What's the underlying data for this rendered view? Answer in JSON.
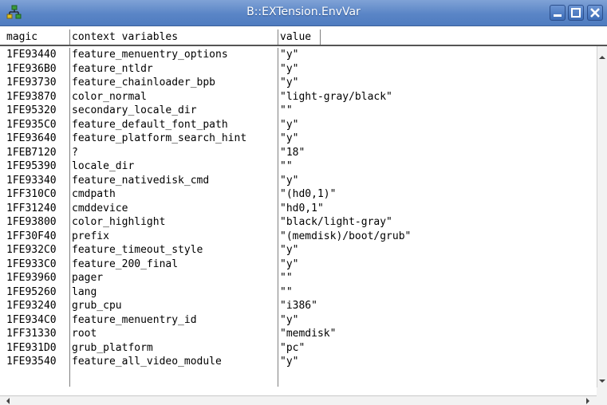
{
  "window": {
    "title": "B::EXTension.EnvVar",
    "icon": "app-network-icon",
    "controls": [
      "minimize-icon",
      "maximize-icon",
      "close-icon"
    ],
    "titlebar_color": "#5a85c6"
  },
  "table": {
    "headers": {
      "magic": "magic",
      "name": "context variables",
      "value": "value"
    },
    "rows": [
      {
        "magic": "1FE93440",
        "name": "feature_menuentry_options",
        "value": "\"y\""
      },
      {
        "magic": "1FE936B0",
        "name": "feature_ntldr",
        "value": "\"y\""
      },
      {
        "magic": "1FE93730",
        "name": "feature_chainloader_bpb",
        "value": "\"y\""
      },
      {
        "magic": "1FE93870",
        "name": "color_normal",
        "value": "\"light-gray/black\""
      },
      {
        "magic": "1FE95320",
        "name": "secondary_locale_dir",
        "value": "\"\""
      },
      {
        "magic": "1FE935C0",
        "name": "feature_default_font_path",
        "value": "\"y\""
      },
      {
        "magic": "1FE93640",
        "name": "feature_platform_search_hint",
        "value": "\"y\""
      },
      {
        "magic": "1FEB7120",
        "name": "?",
        "value": "\"18\""
      },
      {
        "magic": "1FE95390",
        "name": "locale_dir",
        "value": "\"\""
      },
      {
        "magic": "1FE93340",
        "name": "feature_nativedisk_cmd",
        "value": "\"y\""
      },
      {
        "magic": "1FF310C0",
        "name": "cmdpath",
        "value": "\"(hd0,1)\""
      },
      {
        "magic": "1FF31240",
        "name": "cmddevice",
        "value": "\"hd0,1\""
      },
      {
        "magic": "1FE93800",
        "name": "color_highlight",
        "value": "\"black/light-gray\""
      },
      {
        "magic": "1FF30F40",
        "name": "prefix",
        "value": "\"(memdisk)/boot/grub\""
      },
      {
        "magic": "1FE932C0",
        "name": "feature_timeout_style",
        "value": "\"y\""
      },
      {
        "magic": "1FE933C0",
        "name": "feature_200_final",
        "value": "\"y\""
      },
      {
        "magic": "1FE93960",
        "name": "pager",
        "value": "\"\""
      },
      {
        "magic": "1FE95260",
        "name": "lang",
        "value": "\"\""
      },
      {
        "magic": "1FE93240",
        "name": "grub_cpu",
        "value": "\"i386\""
      },
      {
        "magic": "1FE934C0",
        "name": "feature_menuentry_id",
        "value": "\"y\""
      },
      {
        "magic": "1FF31330",
        "name": "root",
        "value": "\"memdisk\""
      },
      {
        "magic": "1FE931D0",
        "name": "grub_platform",
        "value": "\"pc\""
      },
      {
        "magic": "1FE93540",
        "name": "feature_all_video_module",
        "value": "\"y\""
      }
    ]
  }
}
